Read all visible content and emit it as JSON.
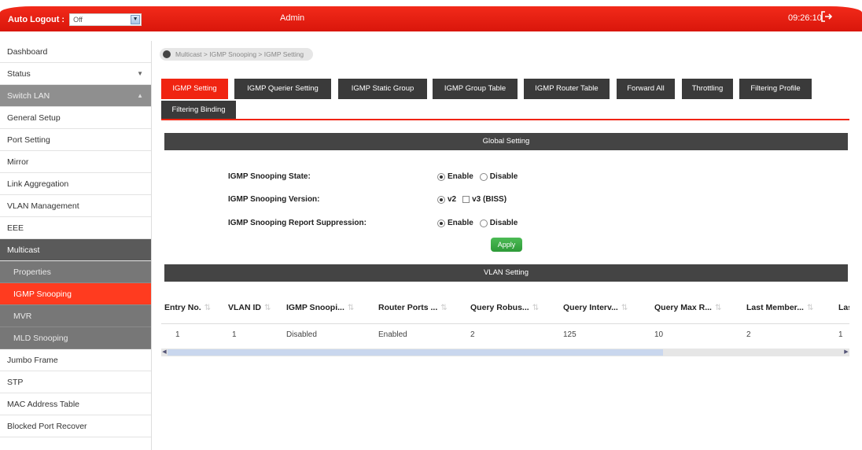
{
  "header": {
    "auto_logout_label": "Auto Logout :",
    "auto_logout_value": "Off",
    "user": "Admin",
    "clock": "09:26:10"
  },
  "sidebar": {
    "items": [
      {
        "label": "Dashboard"
      },
      {
        "label": "Status"
      },
      {
        "label": "Switch LAN"
      },
      {
        "label": "General Setup"
      },
      {
        "label": "Port Setting"
      },
      {
        "label": "Mirror"
      },
      {
        "label": "Link Aggregation"
      },
      {
        "label": "VLAN Management"
      },
      {
        "label": "EEE"
      },
      {
        "label": "Multicast"
      },
      {
        "label": "Properties"
      },
      {
        "label": "IGMP Snooping"
      },
      {
        "label": "MVR"
      },
      {
        "label": "MLD Snooping"
      },
      {
        "label": "Jumbo Frame"
      },
      {
        "label": "STP"
      },
      {
        "label": "MAC Address Table"
      },
      {
        "label": "Blocked Port Recover"
      }
    ]
  },
  "breadcrumb": "Multicast > IGMP Snooping > IGMP Setting",
  "tabs": [
    {
      "label": "IGMP Setting"
    },
    {
      "label": "IGMP Querier Setting"
    },
    {
      "label": "IGMP Static Group"
    },
    {
      "label": "IGMP Group Table"
    },
    {
      "label": "IGMP Router Table"
    },
    {
      "label": "Forward All"
    },
    {
      "label": "Throttling"
    },
    {
      "label": "Filtering Profile"
    },
    {
      "label": "Filtering Binding"
    }
  ],
  "global": {
    "title": "Global Setting",
    "state_label": "IGMP Snooping State:",
    "version_label": "IGMP Snooping Version:",
    "suppression_label": "IGMP Snooping Report Suppression:",
    "enable": "Enable",
    "disable": "Disable",
    "v2": "v2",
    "v3": "v3 (BISS)",
    "apply": "Apply"
  },
  "vlan": {
    "title": "VLAN Setting",
    "columns": [
      "Entry No.",
      "VLAN ID",
      "IGMP Snoopi...",
      "Router Ports ...",
      "Query Robus...",
      "Query Interv...",
      "Query Max R...",
      "Last Member...",
      "Las"
    ],
    "row": [
      "1",
      "1",
      "Disabled",
      "Enabled",
      "2",
      "125",
      "10",
      "2",
      "1"
    ]
  },
  "colors": {
    "accent": "#f02411",
    "dark": "#3a3a3a",
    "apply": "#2e9a38"
  }
}
